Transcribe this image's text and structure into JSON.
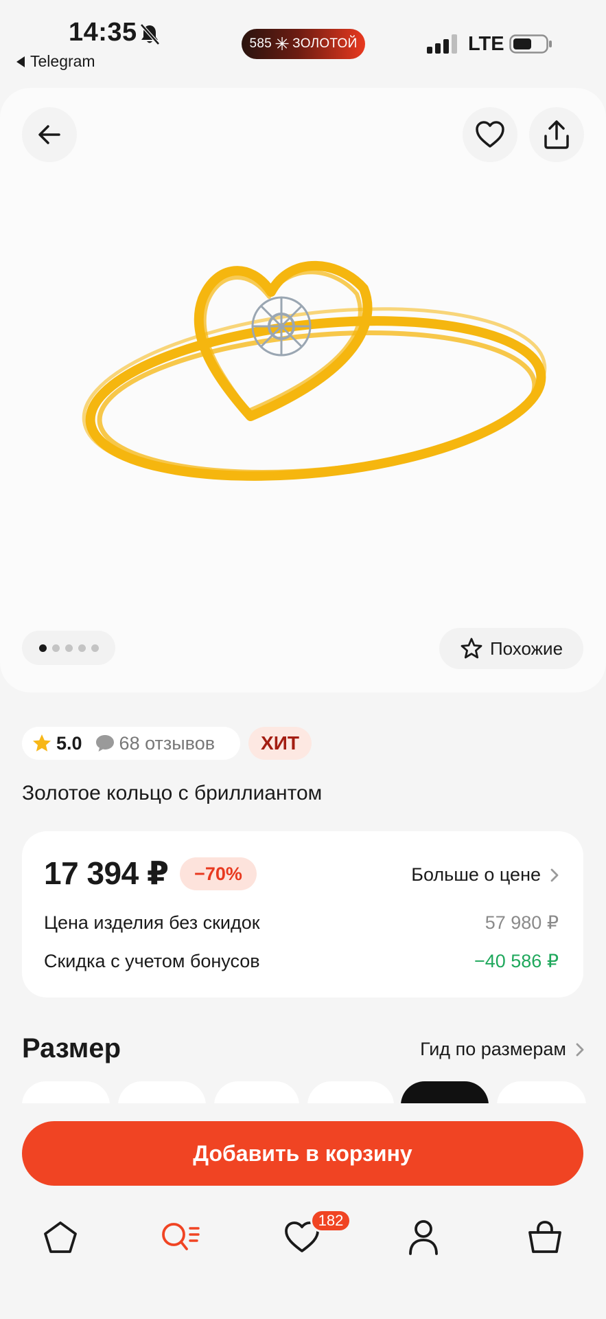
{
  "status_bar": {
    "time": "14:35",
    "back_app": "Telegram",
    "brand_pill": {
      "left": "585",
      "right": "ЗОЛОТОЙ"
    },
    "network": "LTE"
  },
  "hero": {
    "image_count": 5,
    "active_image": 1,
    "similar_label": "Похожие"
  },
  "product": {
    "rating": "5.0",
    "reviews": "68 отзывов",
    "badge": "ХИТ",
    "title": "Золотое кольцо с бриллиантом"
  },
  "price": {
    "current": "17 394 ₽",
    "discount": "−70%",
    "more_label": "Больше о цене",
    "rows": [
      {
        "label": "Цена изделия без скидок",
        "value": "57 980 ₽"
      },
      {
        "label": "Скидка с учетом бонусов",
        "value": "−40 586 ₽"
      }
    ]
  },
  "size": {
    "title": "Размер",
    "guide_label": "Гид по размерам"
  },
  "cart_button": "Добавить в корзину",
  "nav": {
    "favorites_count": "182"
  },
  "colors": {
    "accent": "#f04423",
    "ring_gold": "#f5b60f",
    "green": "#1fa85c"
  }
}
